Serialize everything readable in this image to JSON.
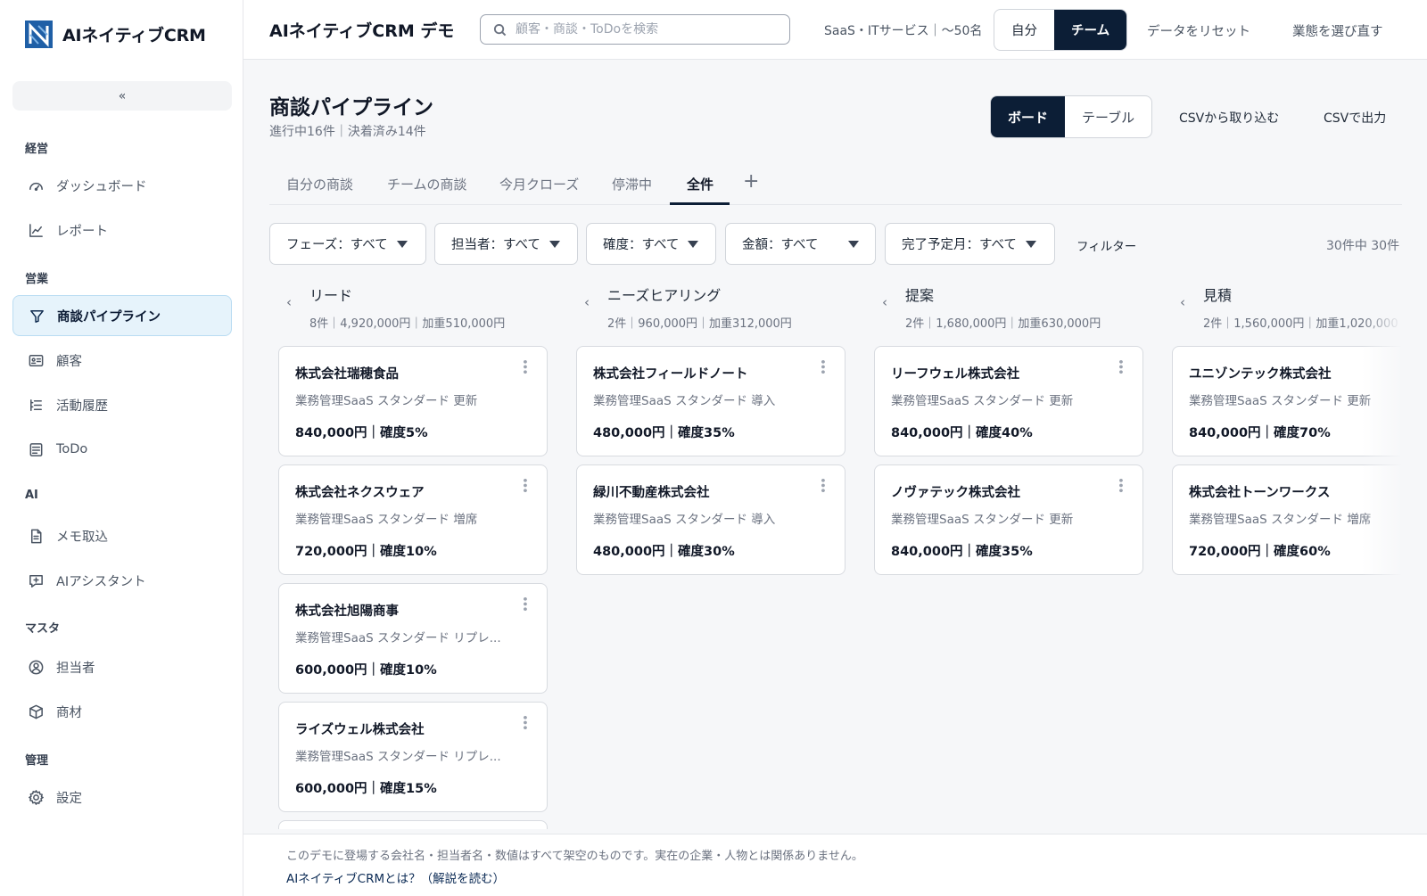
{
  "sidebar": {
    "logo_text": "AIネイティブCRM",
    "collapse_label": "«",
    "sections": [
      "経営",
      "営業",
      "AI",
      "マスタ",
      "管理"
    ],
    "items": [
      {
        "label": "ダッシュボード",
        "icon": "gauge-icon"
      },
      {
        "label": "レポート",
        "icon": "line-chart-icon"
      },
      {
        "label": "商談パイプライン",
        "icon": "funnel-icon",
        "active": true
      },
      {
        "label": "顧客",
        "icon": "contact-card-icon"
      },
      {
        "label": "活動履歴",
        "icon": "list-icon"
      },
      {
        "label": "ToDo",
        "icon": "checklist-icon"
      },
      {
        "label": "メモ取込",
        "icon": "document-icon"
      },
      {
        "label": "AIアシスタント",
        "icon": "chat-plus-icon"
      },
      {
        "label": "担当者",
        "icon": "user-circle-icon"
      },
      {
        "label": "商材",
        "icon": "box-icon"
      },
      {
        "label": "設定",
        "icon": "gear-icon"
      }
    ]
  },
  "header": {
    "title": "AIネイティブCRM デモ",
    "search_placeholder": "顧客・商談・ToDoを検索",
    "industry": "SaaS・ITサービス｜〜50名",
    "scope_options": [
      "自分",
      "チーム"
    ],
    "scope_selected": "チーム",
    "reset_label": "データをリセット",
    "choose_industry_label": "業態を選び直す"
  },
  "page": {
    "title": "商談パイプライン",
    "subtitle": "進行中16件｜決着済み14件",
    "view_options": [
      "ボード",
      "テーブル"
    ],
    "view_selected": "ボード",
    "csv_import": "CSVから取り込む",
    "csv_export": "CSVで出力"
  },
  "tabs": [
    {
      "label": "自分の商談"
    },
    {
      "label": "チームの商談"
    },
    {
      "label": "今月クローズ"
    },
    {
      "label": "停滞中"
    },
    {
      "label": "全件",
      "active": true
    }
  ],
  "tab_add_label": "+",
  "filters": [
    {
      "label": "フェーズ：すべて"
    },
    {
      "label": "担当者：すべて"
    },
    {
      "label": "確度：すべて"
    },
    {
      "label": "金額：すべて"
    },
    {
      "label": "完了予定月：すべて"
    }
  ],
  "filter_link": "フィルター",
  "result_count": "30件中 30件",
  "columns": [
    {
      "name": "リード",
      "stats": "8件｜4,920,000円｜加重510,000円",
      "cards": [
        {
          "company": "株式会社瑞穂食品",
          "product": "業務管理SaaS スタンダード 更新",
          "value": "840,000円｜確度5%"
        },
        {
          "company": "株式会社ネクスウェア",
          "product": "業務管理SaaS スタンダード 増席",
          "value": "720,000円｜確度10%"
        },
        {
          "company": "株式会社旭陽商事",
          "product": "業務管理SaaS スタンダード リプレ...",
          "value": "600,000円｜確度10%"
        },
        {
          "company": "ライズウェル株式会社",
          "product": "業務管理SaaS スタンダード リプレ...",
          "value": "600,000円｜確度15%"
        }
      ]
    },
    {
      "name": "ニーズヒアリング",
      "stats": "2件｜960,000円｜加重312,000円",
      "cards": [
        {
          "company": "株式会社フィールドノート",
          "product": "業務管理SaaS スタンダード 導入",
          "value": "480,000円｜確度35%"
        },
        {
          "company": "緑川不動産株式会社",
          "product": "業務管理SaaS スタンダード 導入",
          "value": "480,000円｜確度30%"
        }
      ]
    },
    {
      "name": "提案",
      "stats": "2件｜1,680,000円｜加重630,000円",
      "cards": [
        {
          "company": "リーフウェル株式会社",
          "product": "業務管理SaaS スタンダード 更新",
          "value": "840,000円｜確度40%"
        },
        {
          "company": "ノヴァテック株式会社",
          "product": "業務管理SaaS スタンダード 更新",
          "value": "840,000円｜確度35%"
        }
      ]
    },
    {
      "name": "見積",
      "stats": "2件｜1,560,000円｜加重1,020,000",
      "cards": [
        {
          "company": "ユニゾンテック株式会社",
          "product": "業務管理SaaS スタンダード 更新",
          "value": "840,000円｜確度70%"
        },
        {
          "company": "株式会社トーンワークス",
          "product": "業務管理SaaS スタンダード 増席",
          "value": "720,000円｜確度60%"
        }
      ]
    }
  ],
  "footer": {
    "note": "このデモに登場する会社名・担当者名・数値はすべて架空のものです。実在の企業・人物とは関係ありません。",
    "link": "AIネイティブCRMとは？（解説を読む）"
  }
}
